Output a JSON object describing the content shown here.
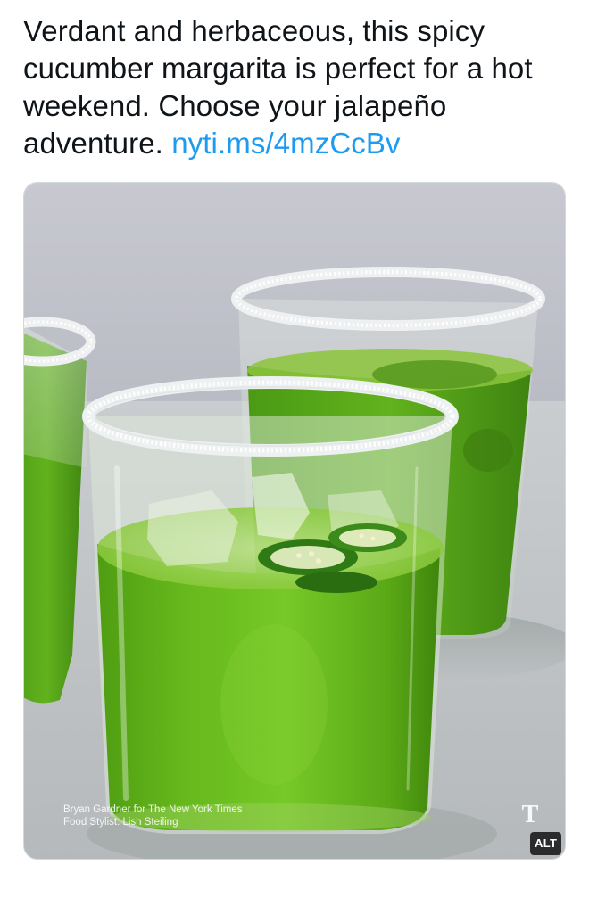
{
  "tweet": {
    "text": "Verdant and herbaceous, this spicy cucumber margarita is perfect for a hot weekend. Choose your jalapeño adventure.",
    "link_text": "nyti.ms/4mzCcBv"
  },
  "media": {
    "credit_line_1": "Bryan Gardner for The New York Times",
    "credit_line_2": "Food Stylist: Lish Steiling",
    "logo_glyph": "T",
    "alt_label": "ALT"
  },
  "colors": {
    "link": "#1d9bf0",
    "text": "#0f1419",
    "drink_green": "#5fbf1c"
  }
}
